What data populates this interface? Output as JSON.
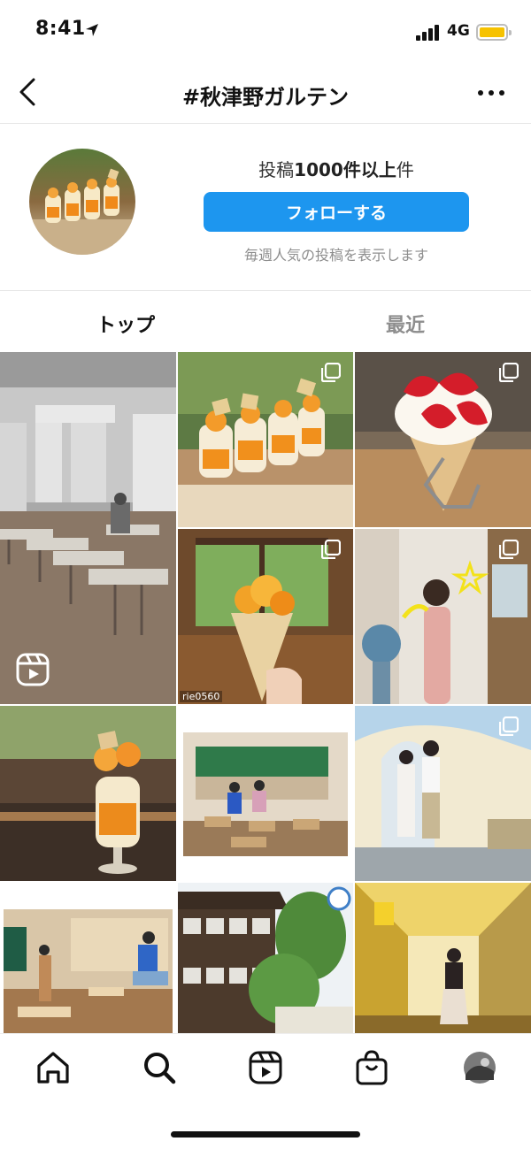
{
  "status_bar": {
    "time": "8:41",
    "network": "4G"
  },
  "header": {
    "title": "#秋津野ガルテン"
  },
  "profile": {
    "post_count_prefix": "投稿",
    "post_count_value": "1000件以上",
    "post_count_suffix": "件",
    "follow_label": "フォローする",
    "weekly_note": "毎週人気の投稿を表示します"
  },
  "tabs": [
    {
      "label": "トップ",
      "active": true
    },
    {
      "label": "最近",
      "active": false
    }
  ],
  "grid": {
    "tiles": [
      {
        "subject": "classroom-video",
        "type": "reel"
      },
      {
        "subject": "parfait-glasses",
        "type": "carousel"
      },
      {
        "subject": "strawberry-crepe",
        "type": "carousel"
      },
      {
        "subject": "crepe-in-hand",
        "type": "carousel",
        "label": "rie0560"
      },
      {
        "subject": "woman-pink-dress",
        "type": "carousel"
      },
      {
        "subject": "parfait-closeup",
        "type": "single"
      },
      {
        "subject": "classroom-photo",
        "type": "single"
      },
      {
        "subject": "couple-arch",
        "type": "carousel"
      },
      {
        "subject": "classroom-pose",
        "type": "single"
      },
      {
        "subject": "wooden-school",
        "type": "single"
      },
      {
        "subject": "hallway-woman",
        "type": "single"
      }
    ]
  },
  "bottom_nav": [
    "home-icon",
    "search-icon",
    "reels-icon",
    "shop-icon",
    "profile-avatar"
  ],
  "colors": {
    "accent": "#1d96ef",
    "muted": "#8e8e8e",
    "battery": "#f6c200"
  }
}
